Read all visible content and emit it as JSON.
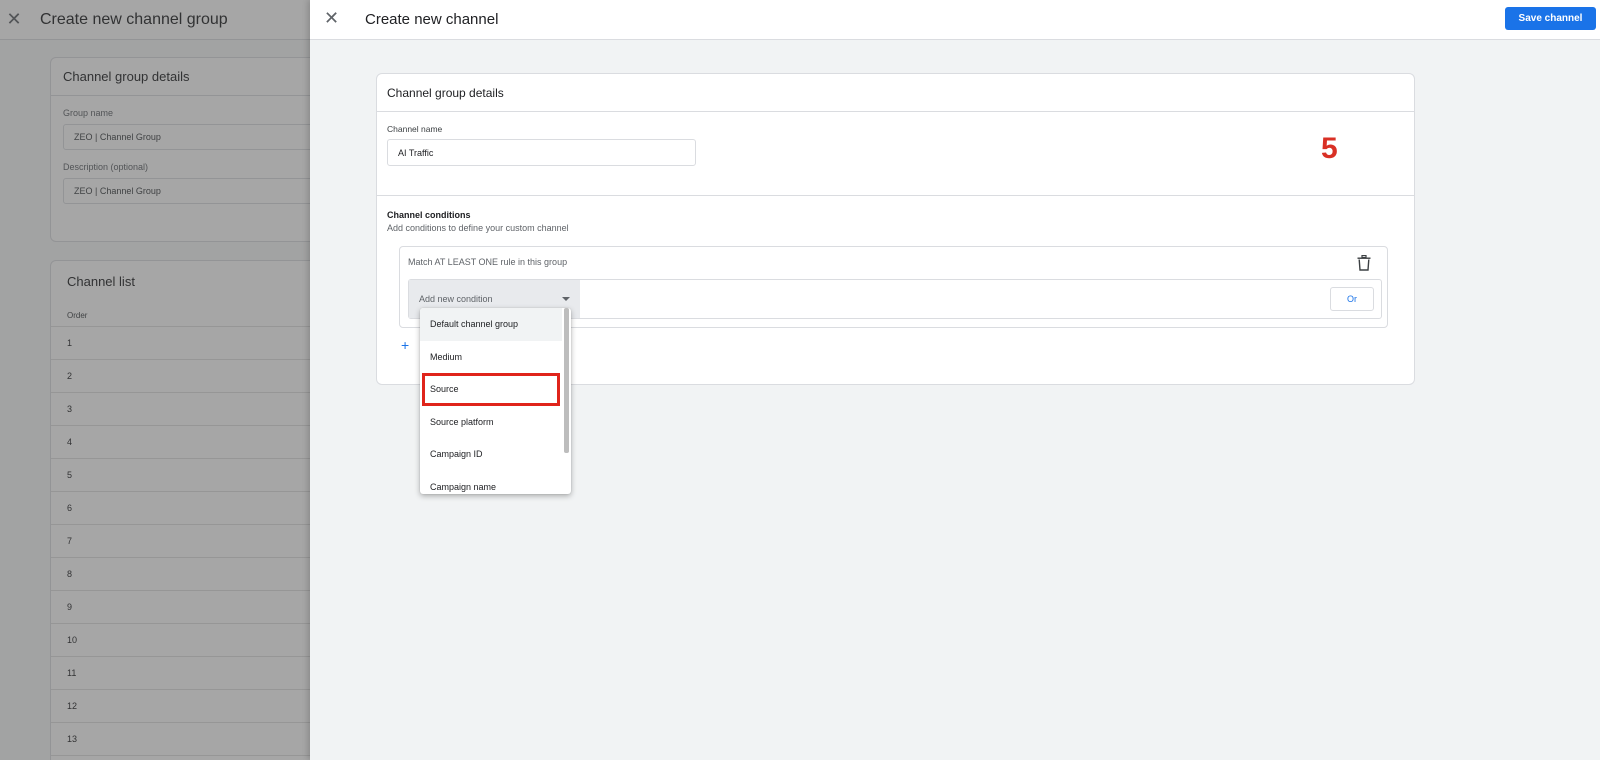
{
  "background_panel": {
    "title": "Create new channel group",
    "details_card": {
      "title": "Channel group details",
      "group_name_label": "Group name",
      "group_name_value": "ZEO | Channel Group",
      "description_label": "Description (optional)",
      "description_value": "ZEO | Channel Group"
    },
    "channel_list": {
      "title": "Channel list",
      "order_header": "Order",
      "rows": [
        "1",
        "2",
        "3",
        "4",
        "5",
        "6",
        "7",
        "8",
        "9",
        "10",
        "11",
        "12",
        "13"
      ]
    }
  },
  "sheet": {
    "title": "Create new channel",
    "save_label": "Save channel",
    "card_title": "Channel group details",
    "channel_name_label": "Channel name",
    "channel_name_value": "AI Traffic",
    "step_number": "5",
    "conditions_title": "Channel conditions",
    "conditions_subtitle": "Add conditions to define your custom channel",
    "rule_group_label": "Match AT LEAST ONE rule in this group",
    "condition_placeholder": "Add new condition",
    "or_label": "Or",
    "add_symbol": "+"
  },
  "dropdown": {
    "items": [
      "Default channel group",
      "Medium",
      "Source",
      "Source platform",
      "Campaign ID",
      "Campaign name"
    ],
    "hovered_index": 0,
    "selected_index": 2
  },
  "colors": {
    "primary": "#1a73e8",
    "highlight": "#e0241b",
    "step_number": "#d93025"
  },
  "icons": {
    "close": "close-icon",
    "delete": "trash-icon",
    "caret": "chevron-down-icon",
    "add": "plus-icon"
  }
}
